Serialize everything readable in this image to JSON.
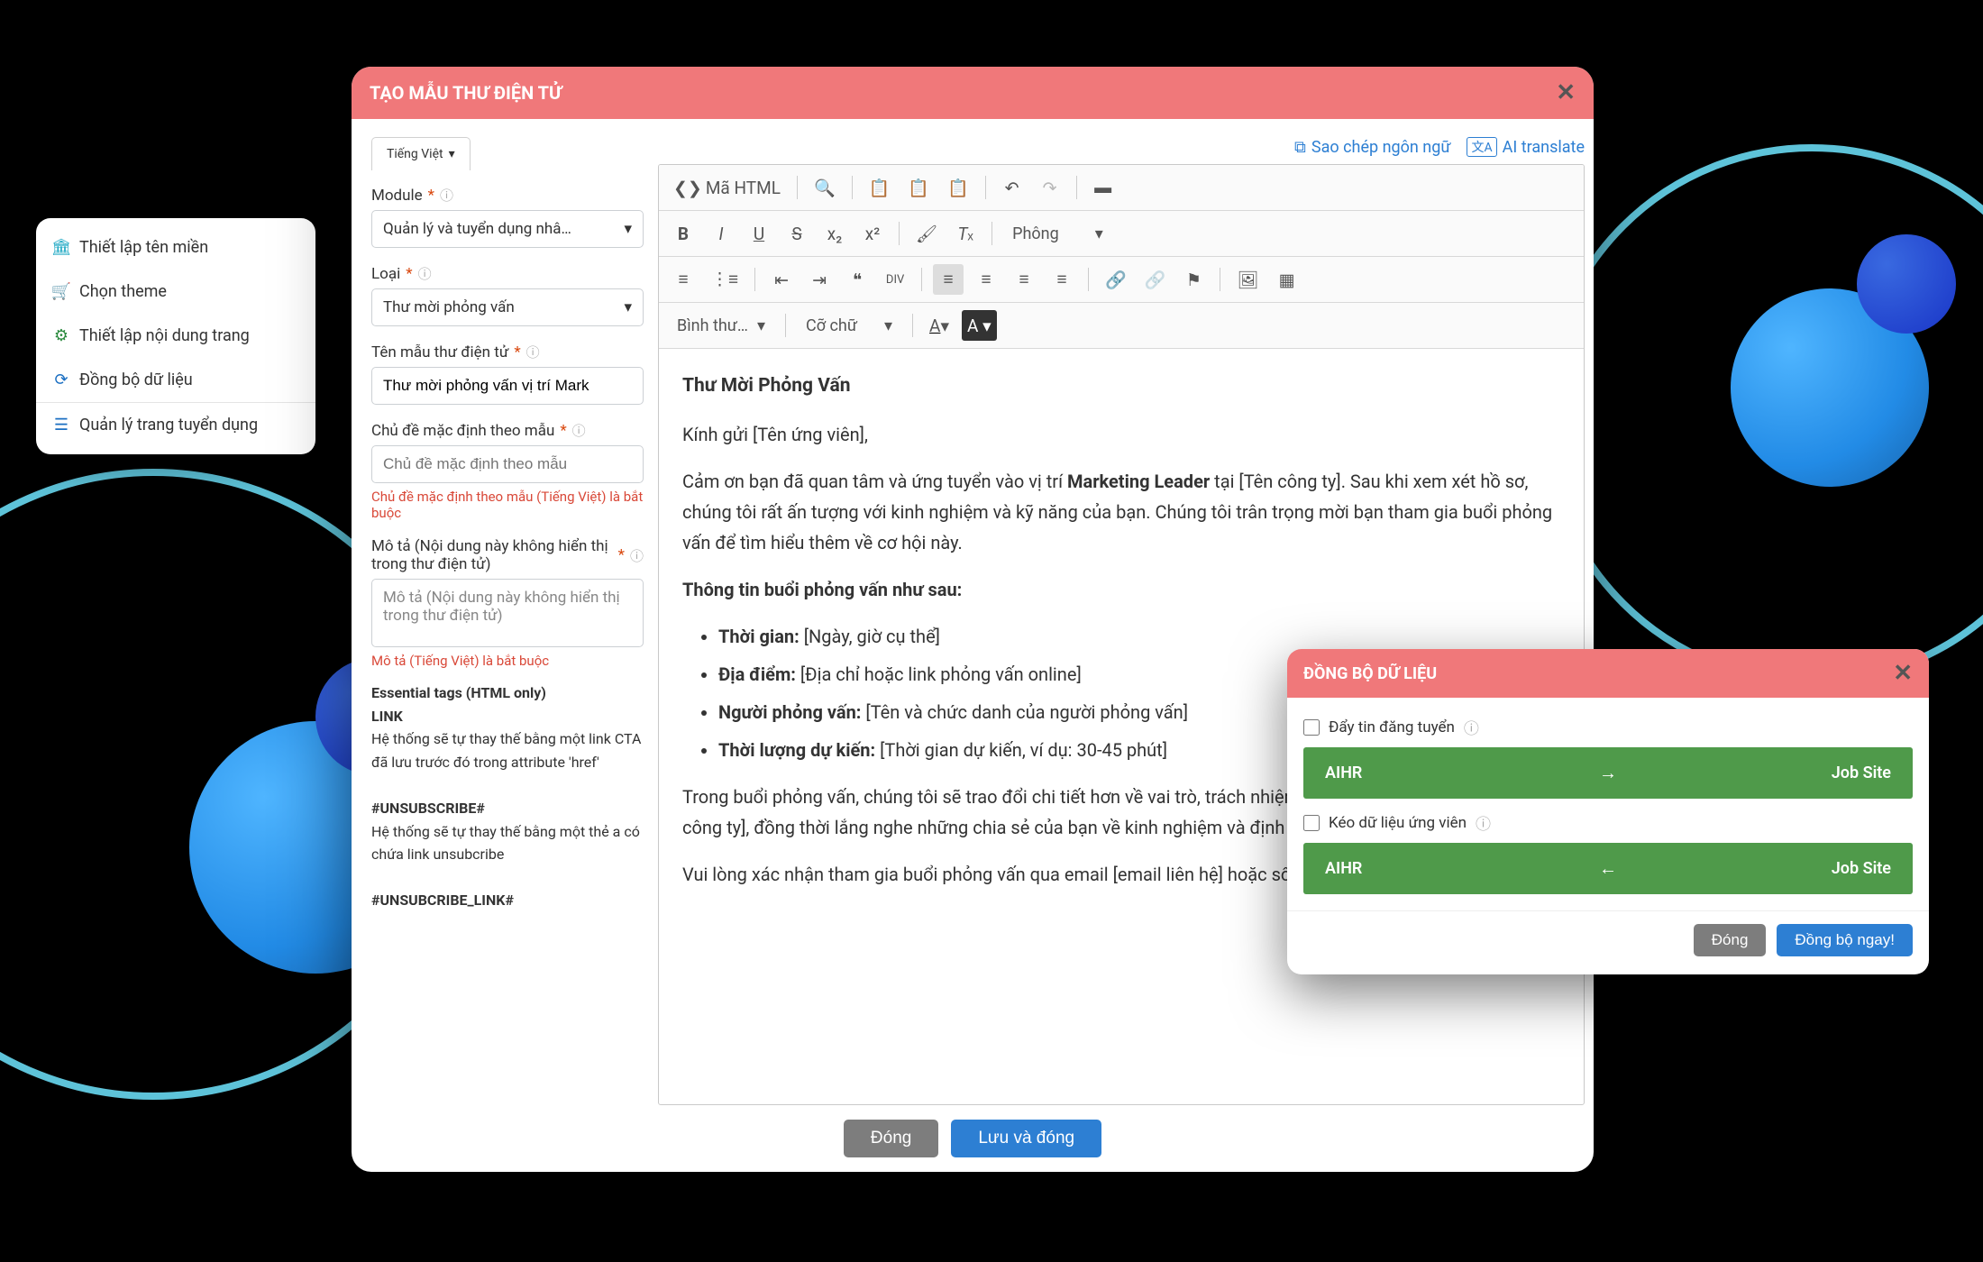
{
  "sideNav": {
    "items": [
      {
        "icon": "🏛",
        "label": "Thiết lập tên miền"
      },
      {
        "icon": "🛒",
        "label": "Chọn theme"
      },
      {
        "icon": "⚙",
        "label": "Thiết lập nội dung trang"
      },
      {
        "icon": "⟳",
        "label": "Đồng bộ dữ liệu"
      },
      {
        "icon": "☰",
        "label": "Quản lý trang tuyển dụng"
      }
    ]
  },
  "mainModal": {
    "title": "TẠO MẪU THƯ ĐIỆN TỬ",
    "langTab": "Tiếng Việt",
    "copyLang": "Sao chép ngôn ngữ",
    "aiTranslate": "AI translate",
    "fields": {
      "module": {
        "label": "Module",
        "value": "Quản lý và tuyển dụng nhâ…"
      },
      "loai": {
        "label": "Loại",
        "value": "Thư mời phỏng vấn"
      },
      "tenMau": {
        "label": "Tên mẫu thư điện tử",
        "value": "Thư mời phỏng vấn vị trí Mark"
      },
      "chuDe": {
        "label": "Chủ đề mặc định theo mẫu",
        "placeholder": "Chủ đề mặc định theo mẫu",
        "error": "Chủ đề mặc định theo mẫu (Tiếng Việt) là bắt buộc"
      },
      "moTa": {
        "label": "Mô tả (Nội dung này không hiển thị trong thư điện tử)",
        "placeholder": "Mô tả (Nội dung này không hiển thị trong thư điện tử)",
        "error": "Mô tả (Tiếng Việt) là bắt buộc"
      }
    },
    "essentialTagsTitle": "Essential tags (HTML only)",
    "linkTag": "LINK",
    "linkDesc": "Hệ thống sẽ tự thay thế bằng một link CTA đã lưu trước đó trong attribute 'href'",
    "unsubTag": "#UNSUBSCRIBE#",
    "unsubDesc": "Hệ thống sẽ tự thay thế bằng một thẻ a có chứa link unsubcribe",
    "unsubLinkTag": "#UNSUBCRIBE_LINK#",
    "toolbar": {
      "html": "Mã HTML",
      "font": "Phông",
      "paragraph": "Bình thư…",
      "size": "Cỡ chữ"
    },
    "content": {
      "title": "Thư Mời Phỏng Vấn",
      "greeting": "Kính gửi [Tên ứng viên],",
      "p1a": "Cảm ơn bạn đã quan tâm và ứng tuyển vào vị trí ",
      "p1bold": "Marketing Leader",
      "p1b": " tại [Tên công ty]. Sau khi xem xét hồ sơ, chúng tôi rất ấn tượng với kinh nghiệm và kỹ năng của bạn. Chúng tôi trân trọng mời bạn tham gia buổi phỏng vấn để tìm hiểu thêm về cơ hội này.",
      "infoTitle": "Thông tin buổi phỏng vấn như sau:",
      "li1l": "Thời gian:",
      "li1v": " [Ngày, giờ cụ thể]",
      "li2l": "Địa điểm:",
      "li2v": " [Địa chỉ hoặc link phỏng vấn online]",
      "li3l": "Người phỏng vấn:",
      "li3v": " [Tên và chức danh của người phỏng vấn]",
      "li4l": "Thời lượng dự kiến:",
      "li4v": " [Thời gian dự kiến, ví dụ: 30-45 phút]",
      "p2": "Trong buổi phỏng vấn, chúng tôi sẽ trao đổi chi tiết hơn về vai trò, trách nhiệm và cơ hội phát triển tại [Tên công ty], đồng thời lắng nghe những chia sẻ của bạn về kinh nghiệm và định hướng nghề nghiệp.",
      "p3": "Vui lòng xác nhận tham gia buổi phỏng vấn qua email [email liên hệ] hoặc số điện thoại [số"
    },
    "footer": {
      "close": "Đóng",
      "save": "Lưu và đóng"
    }
  },
  "syncModal": {
    "title": "ĐỒNG BỘ DỮ LIỆU",
    "pushLabel": "Đẩy tin đăng tuyển",
    "pullLabel": "Kéo dữ liệu ứng viên",
    "left": "AIHR",
    "right": "Job Site",
    "arrowRight": "→",
    "arrowLeft": "←",
    "footer": {
      "close": "Đóng",
      "sync": "Đồng bộ ngay!"
    }
  }
}
